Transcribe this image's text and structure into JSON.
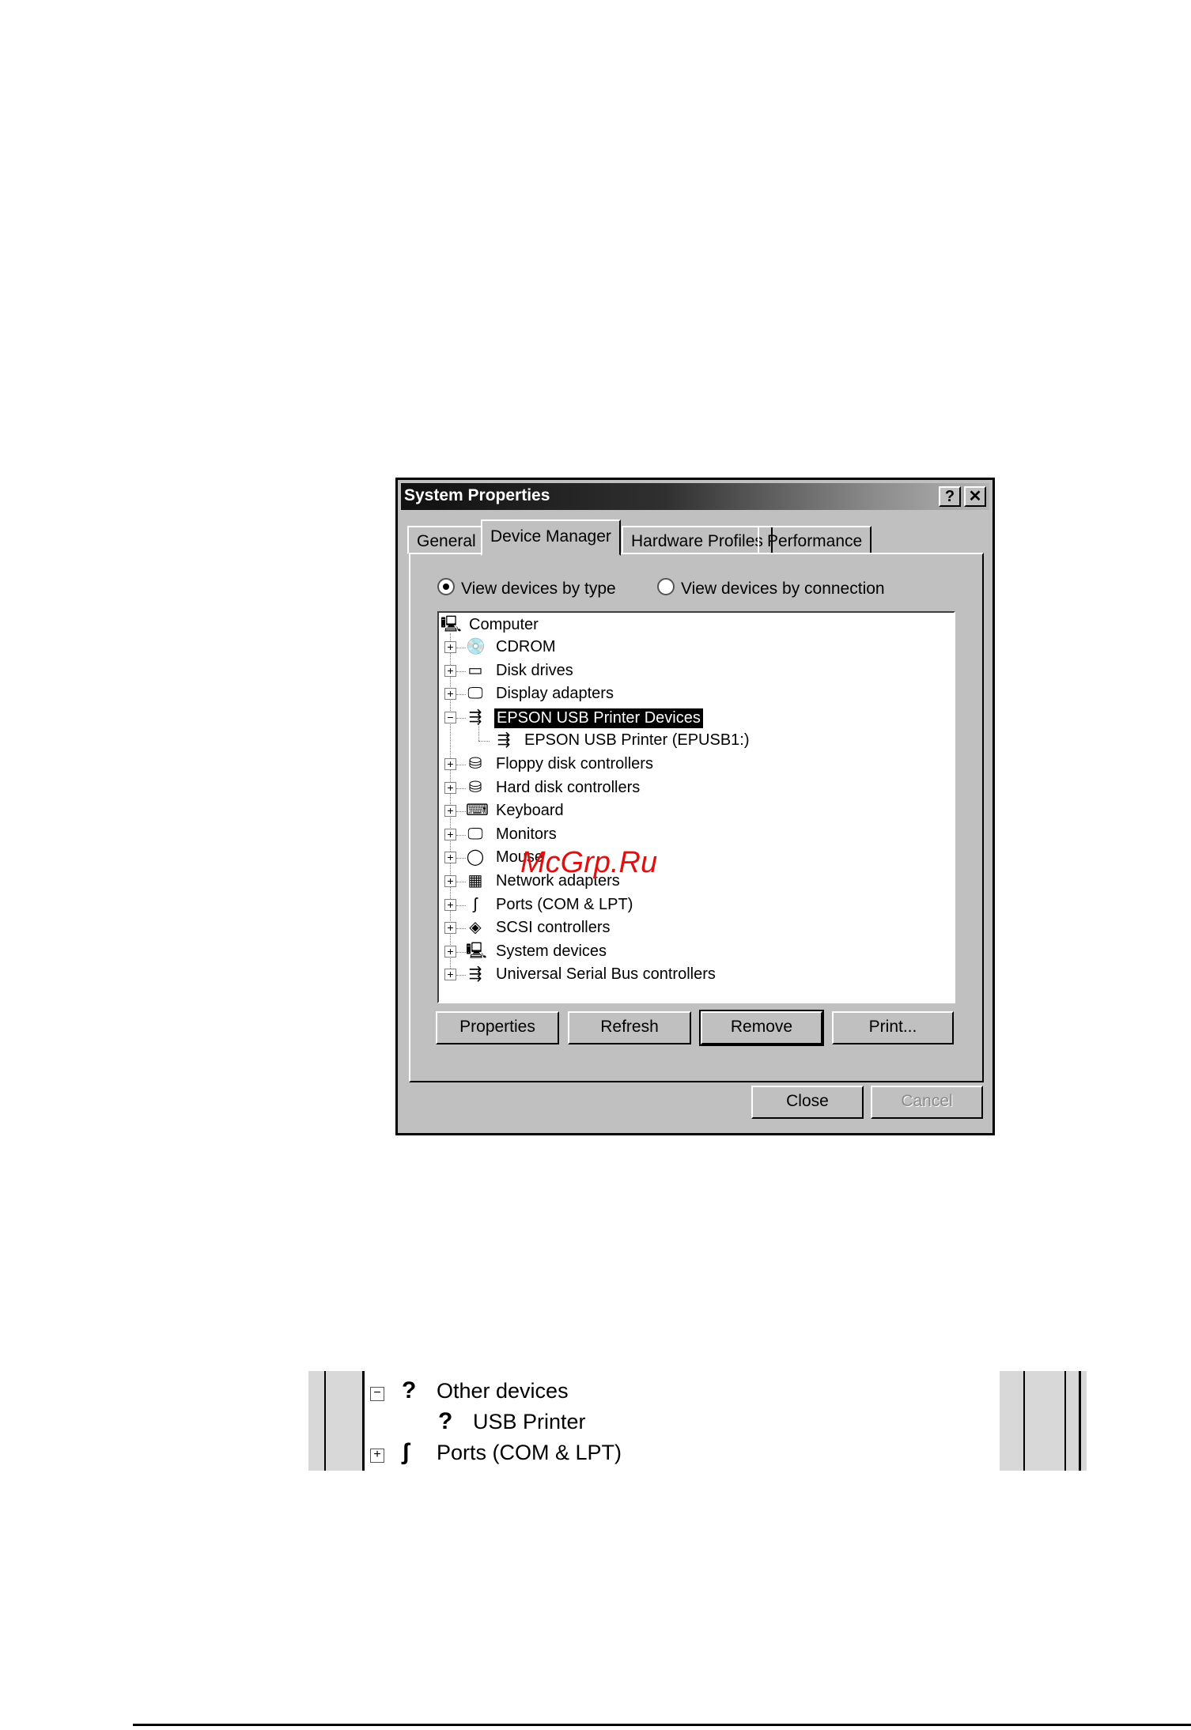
{
  "window": {
    "title": "System Properties",
    "help_label": "?",
    "close_label": "✕"
  },
  "tabs": [
    {
      "label": "General"
    },
    {
      "label": "Device Manager"
    },
    {
      "label": "Hardware Profiles"
    },
    {
      "label": "Performance"
    }
  ],
  "view_options": {
    "by_type": "View devices by type",
    "by_connection": "View devices by connection",
    "selected": "by_type"
  },
  "tree": {
    "root": "Computer",
    "items": [
      {
        "label": "CDROM",
        "icon": "cdrom-icon",
        "expander": "+"
      },
      {
        "label": "Disk drives",
        "icon": "disk-drive-icon",
        "expander": "+"
      },
      {
        "label": "Display adapters",
        "icon": "display-adapter-icon",
        "expander": "+"
      },
      {
        "label": "EPSON USB Printer Devices",
        "icon": "usb-icon",
        "expander": "−",
        "selected": true
      },
      {
        "label": "EPSON USB Printer (EPUSB1:)",
        "icon": "usb-icon",
        "child": true
      },
      {
        "label": "Floppy disk controllers",
        "icon": "floppy-controller-icon",
        "expander": "+"
      },
      {
        "label": "Hard disk controllers",
        "icon": "hard-disk-controller-icon",
        "expander": "+"
      },
      {
        "label": "Keyboard",
        "icon": "keyboard-icon",
        "expander": "+"
      },
      {
        "label": "Monitors",
        "icon": "monitor-icon",
        "expander": "+"
      },
      {
        "label": "Mouse",
        "icon": "mouse-icon",
        "expander": "+"
      },
      {
        "label": "Network adapters",
        "icon": "network-adapter-icon",
        "expander": "+"
      },
      {
        "label": "Ports (COM & LPT)",
        "icon": "port-icon",
        "expander": "+"
      },
      {
        "label": "SCSI controllers",
        "icon": "scsi-icon",
        "expander": "+"
      },
      {
        "label": "System devices",
        "icon": "system-device-icon",
        "expander": "+"
      },
      {
        "label": "Universal Serial Bus controllers",
        "icon": "usb-icon",
        "expander": "+"
      }
    ]
  },
  "buttons": {
    "properties": "Properties",
    "refresh": "Refresh",
    "remove": "Remove",
    "print": "Print...",
    "close": "Close",
    "cancel": "Cancel"
  },
  "watermark": "McGrp.Ru",
  "fragment": {
    "rows": [
      {
        "label": "Other devices",
        "icon": "question-icon",
        "expander": "−"
      },
      {
        "label": "USB Printer",
        "icon": "question-device-icon",
        "child": true
      },
      {
        "label": "Ports (COM & LPT)",
        "icon": "port-icon",
        "expander": "+"
      }
    ]
  }
}
